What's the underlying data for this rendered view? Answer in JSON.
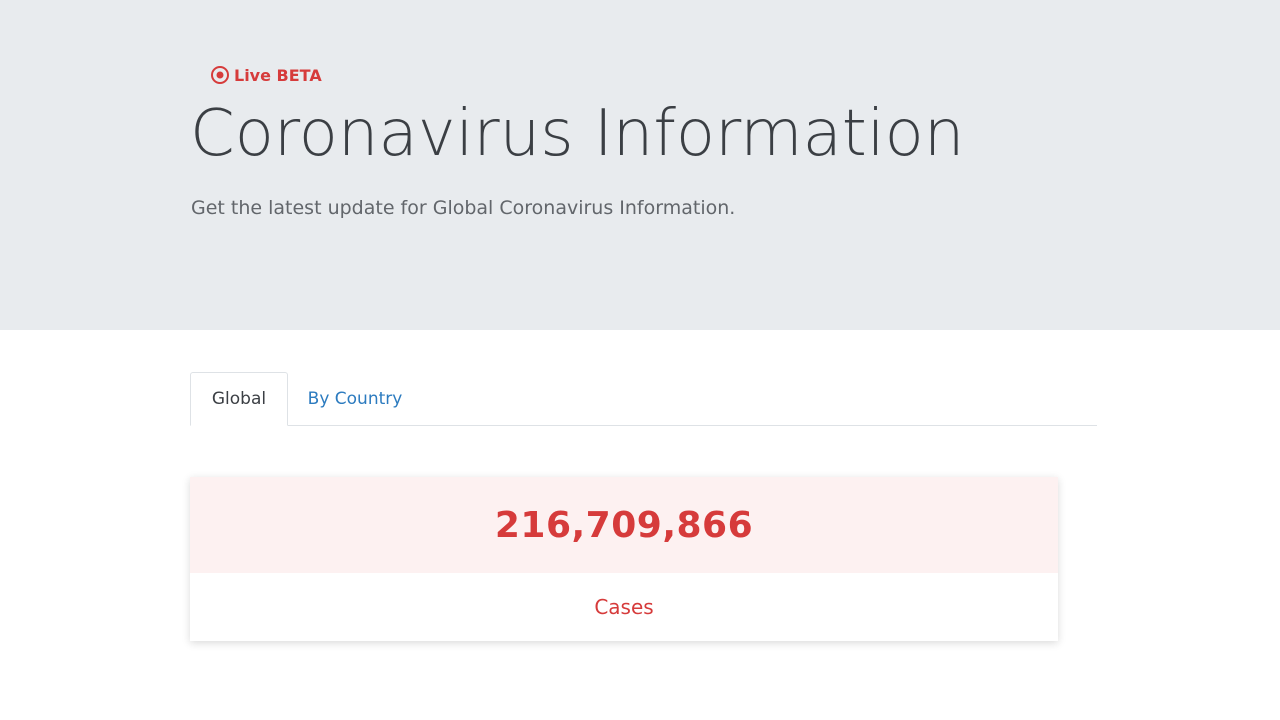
{
  "hero": {
    "badge": {
      "icon": "live-dot-icon",
      "label": "Live BETA",
      "color": "#d63b3b"
    },
    "title": "Coronavirus Information",
    "subtitle": "Get the latest update for Global Coronavirus Information.",
    "background": "#e8ebee"
  },
  "tabs": [
    {
      "label": "Global",
      "active": true
    },
    {
      "label": "By Country",
      "active": false,
      "color": "#2c7bbf"
    }
  ],
  "stat_card": {
    "value": "216,709,866",
    "label": "Cases",
    "accent": "#d63b3b",
    "value_background": "#fdf1f1"
  }
}
